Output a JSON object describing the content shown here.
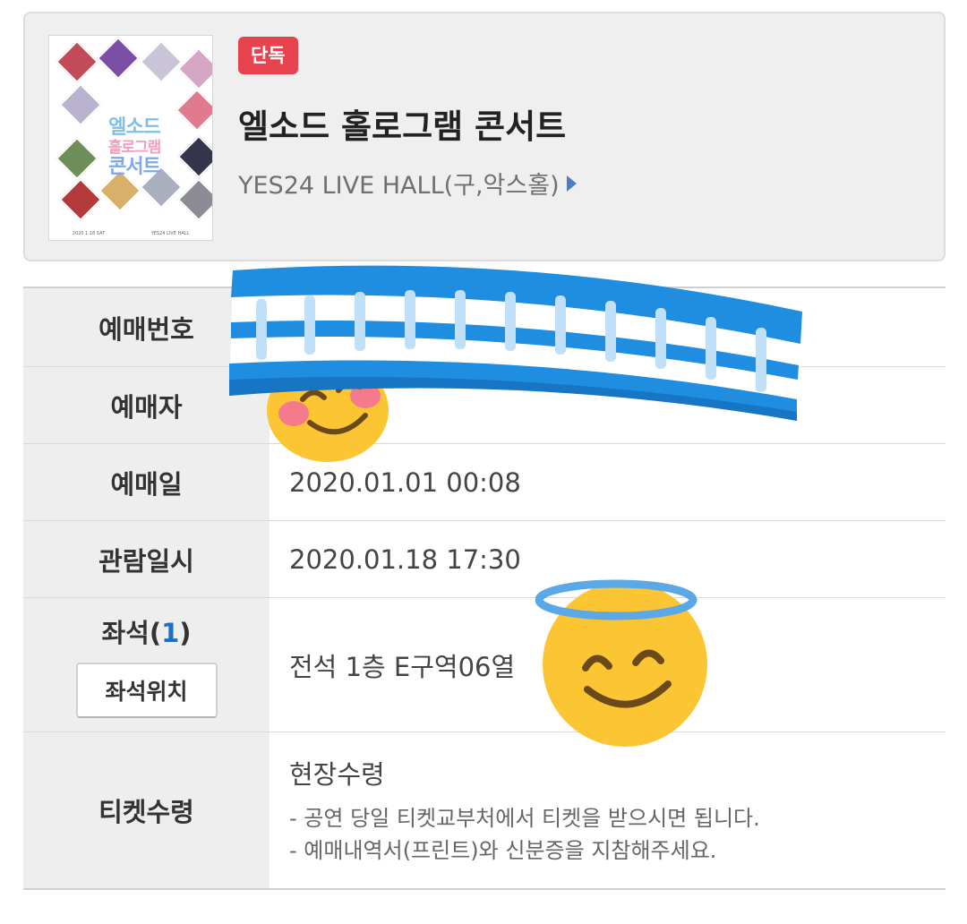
{
  "event": {
    "badge": "단독",
    "title": "엘소드 홀로그램 콘서트",
    "venue": "YES24 LIVE HALL(구,악스홀)",
    "poster": {
      "title_lines": [
        "엘소드",
        "홀로그램",
        "콘서트"
      ],
      "caption_left": "2020.1.18 SAT",
      "caption_right": "YES24 LIVE HALL"
    }
  },
  "rows": {
    "booking_no": {
      "label": "예매번호",
      "value": ""
    },
    "booker": {
      "label": "예매자",
      "value": ""
    },
    "booking_date": {
      "label": "예매일",
      "value": "2020.01.01 00:08"
    },
    "viewing_date": {
      "label": "관람일시",
      "value": "2020.01.18 17:30"
    },
    "seat": {
      "label": "좌석(",
      "count": "1",
      "label_end": ")",
      "button": "좌석위치",
      "value": "전석 1층 E구역06열"
    },
    "ticket": {
      "label": "티켓수령",
      "method": "현장수령",
      "notes": [
        "- 공연 당일 티켓교부처에서 티켓을 받으시면 됩니다.",
        "- 예매내역서(프린트)와 신분증을 지참해주세요."
      ]
    }
  },
  "stickers": [
    "headband-sticker",
    "blushing-smile-emoji",
    "halo-smile-emoji"
  ],
  "colors": {
    "badge": "#e8424e",
    "venue_arrow": "#4a7ec8",
    "seat_count": "#1e6fc4",
    "label_bg": "#eeeeee",
    "card_bg": "#efefef"
  }
}
